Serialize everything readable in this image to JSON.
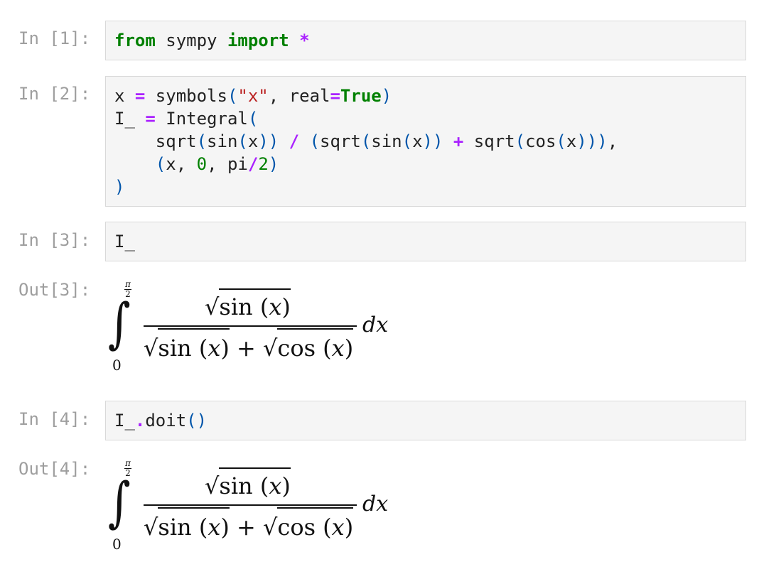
{
  "cells": [
    {
      "prompt": "In [1]:",
      "code_lines": [
        [
          {
            "t": "from",
            "c": "kw"
          },
          {
            "t": " sympy ",
            "c": ""
          },
          {
            "t": "import",
            "c": "kw"
          },
          {
            "t": " ",
            "c": ""
          },
          {
            "t": "*",
            "c": "op"
          }
        ]
      ]
    },
    {
      "prompt": "In [2]:",
      "code_lines": [
        [
          {
            "t": "x ",
            "c": ""
          },
          {
            "t": "=",
            "c": "op"
          },
          {
            "t": " symbols",
            "c": ""
          },
          {
            "t": "(",
            "c": "paren"
          },
          {
            "t": "\"x\"",
            "c": "str"
          },
          {
            "t": ", real",
            "c": ""
          },
          {
            "t": "=",
            "c": "op"
          },
          {
            "t": "True",
            "c": "kw"
          },
          {
            "t": ")",
            "c": "paren"
          }
        ],
        [
          {
            "t": "I_ ",
            "c": ""
          },
          {
            "t": "=",
            "c": "op"
          },
          {
            "t": " Integral",
            "c": ""
          },
          {
            "t": "(",
            "c": "paren"
          }
        ],
        [
          {
            "t": "    sqrt",
            "c": ""
          },
          {
            "t": "(",
            "c": "paren"
          },
          {
            "t": "sin",
            "c": ""
          },
          {
            "t": "(",
            "c": "paren"
          },
          {
            "t": "x",
            "c": ""
          },
          {
            "t": "))",
            "c": "paren"
          },
          {
            "t": " ",
            "c": ""
          },
          {
            "t": "/",
            "c": "op"
          },
          {
            "t": " ",
            "c": ""
          },
          {
            "t": "(",
            "c": "paren"
          },
          {
            "t": "sqrt",
            "c": ""
          },
          {
            "t": "(",
            "c": "paren"
          },
          {
            "t": "sin",
            "c": ""
          },
          {
            "t": "(",
            "c": "paren"
          },
          {
            "t": "x",
            "c": ""
          },
          {
            "t": "))",
            "c": "paren"
          },
          {
            "t": " ",
            "c": ""
          },
          {
            "t": "+",
            "c": "op"
          },
          {
            "t": " sqrt",
            "c": ""
          },
          {
            "t": "(",
            "c": "paren"
          },
          {
            "t": "cos",
            "c": ""
          },
          {
            "t": "(",
            "c": "paren"
          },
          {
            "t": "x",
            "c": ""
          },
          {
            "t": ")))",
            "c": "paren"
          },
          {
            "t": ",",
            "c": ""
          }
        ],
        [
          {
            "t": "    ",
            "c": ""
          },
          {
            "t": "(",
            "c": "paren"
          },
          {
            "t": "x, ",
            "c": ""
          },
          {
            "t": "0",
            "c": "num"
          },
          {
            "t": ", pi",
            "c": ""
          },
          {
            "t": "/",
            "c": "op"
          },
          {
            "t": "2",
            "c": "num"
          },
          {
            "t": ")",
            "c": "paren"
          }
        ],
        [
          {
            "t": ")",
            "c": "paren"
          }
        ]
      ]
    },
    {
      "prompt": "In [3]:",
      "code_lines": [
        [
          {
            "t": "I_",
            "c": ""
          }
        ]
      ]
    },
    {
      "prompt": "In [4]:",
      "code_lines": [
        [
          {
            "t": "I_",
            "c": ""
          },
          {
            "t": ".",
            "c": "op"
          },
          {
            "t": "doit",
            "c": ""
          },
          {
            "t": "()",
            "c": "paren"
          }
        ]
      ]
    }
  ],
  "outputs": [
    {
      "prompt": "Out[3]:",
      "math": {
        "upper_num": "π",
        "upper_den": "2",
        "lower": "0",
        "sin": "sin",
        "cos": "cos",
        "var": "x",
        "plus": "+",
        "dx": "dx"
      }
    },
    {
      "prompt": "Out[4]:",
      "math": {
        "upper_num": "π",
        "upper_den": "2",
        "lower": "0",
        "sin": "sin",
        "cos": "cos",
        "var": "x",
        "plus": "+",
        "dx": "dx"
      }
    }
  ]
}
